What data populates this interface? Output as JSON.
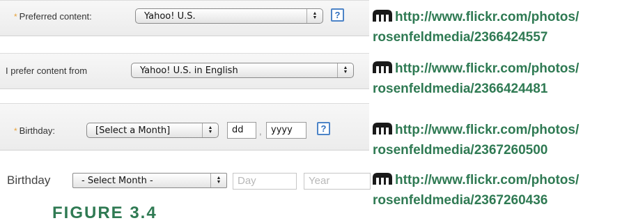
{
  "rows": [
    {
      "label": "Preferred content:",
      "required": true,
      "select_value": "Yahoo! U.S.",
      "help": "?"
    },
    {
      "label": "I prefer content from",
      "required": false,
      "select_value": "Yahoo! U.S. in English"
    },
    {
      "label": "Birthday:",
      "required": true,
      "select_value": "[Select a Month]",
      "day_value": "dd",
      "separator": ",",
      "year_value": "yyyy",
      "help": "?"
    },
    {
      "label": "Birthday",
      "required": false,
      "select_value": "- Select Month -",
      "day_placeholder": "Day",
      "year_placeholder": "Year"
    }
  ],
  "credits": [
    {
      "line1": "http://www.flickr.com/photos/",
      "line2": "rosenfeldmedia/2366424557"
    },
    {
      "line1": "http://www.flickr.com/photos/",
      "line2": "rosenfeldmedia/2366424481"
    },
    {
      "line1": "http://www.flickr.com/photos/",
      "line2": "rosenfeldmedia/2367260500"
    },
    {
      "line1": "http://www.flickr.com/photos/",
      "line2": "rosenfeldmedia/2367260436"
    }
  ],
  "caption": "FIGURE 3.4",
  "required_marker": "*",
  "icons": {
    "credit": "creative-commons-attribution-icon",
    "select": "select-up-down-arrows-icon"
  },
  "colors": {
    "link": "#2f7a53",
    "required": "#e8a33b",
    "help": "#4d84c7"
  }
}
